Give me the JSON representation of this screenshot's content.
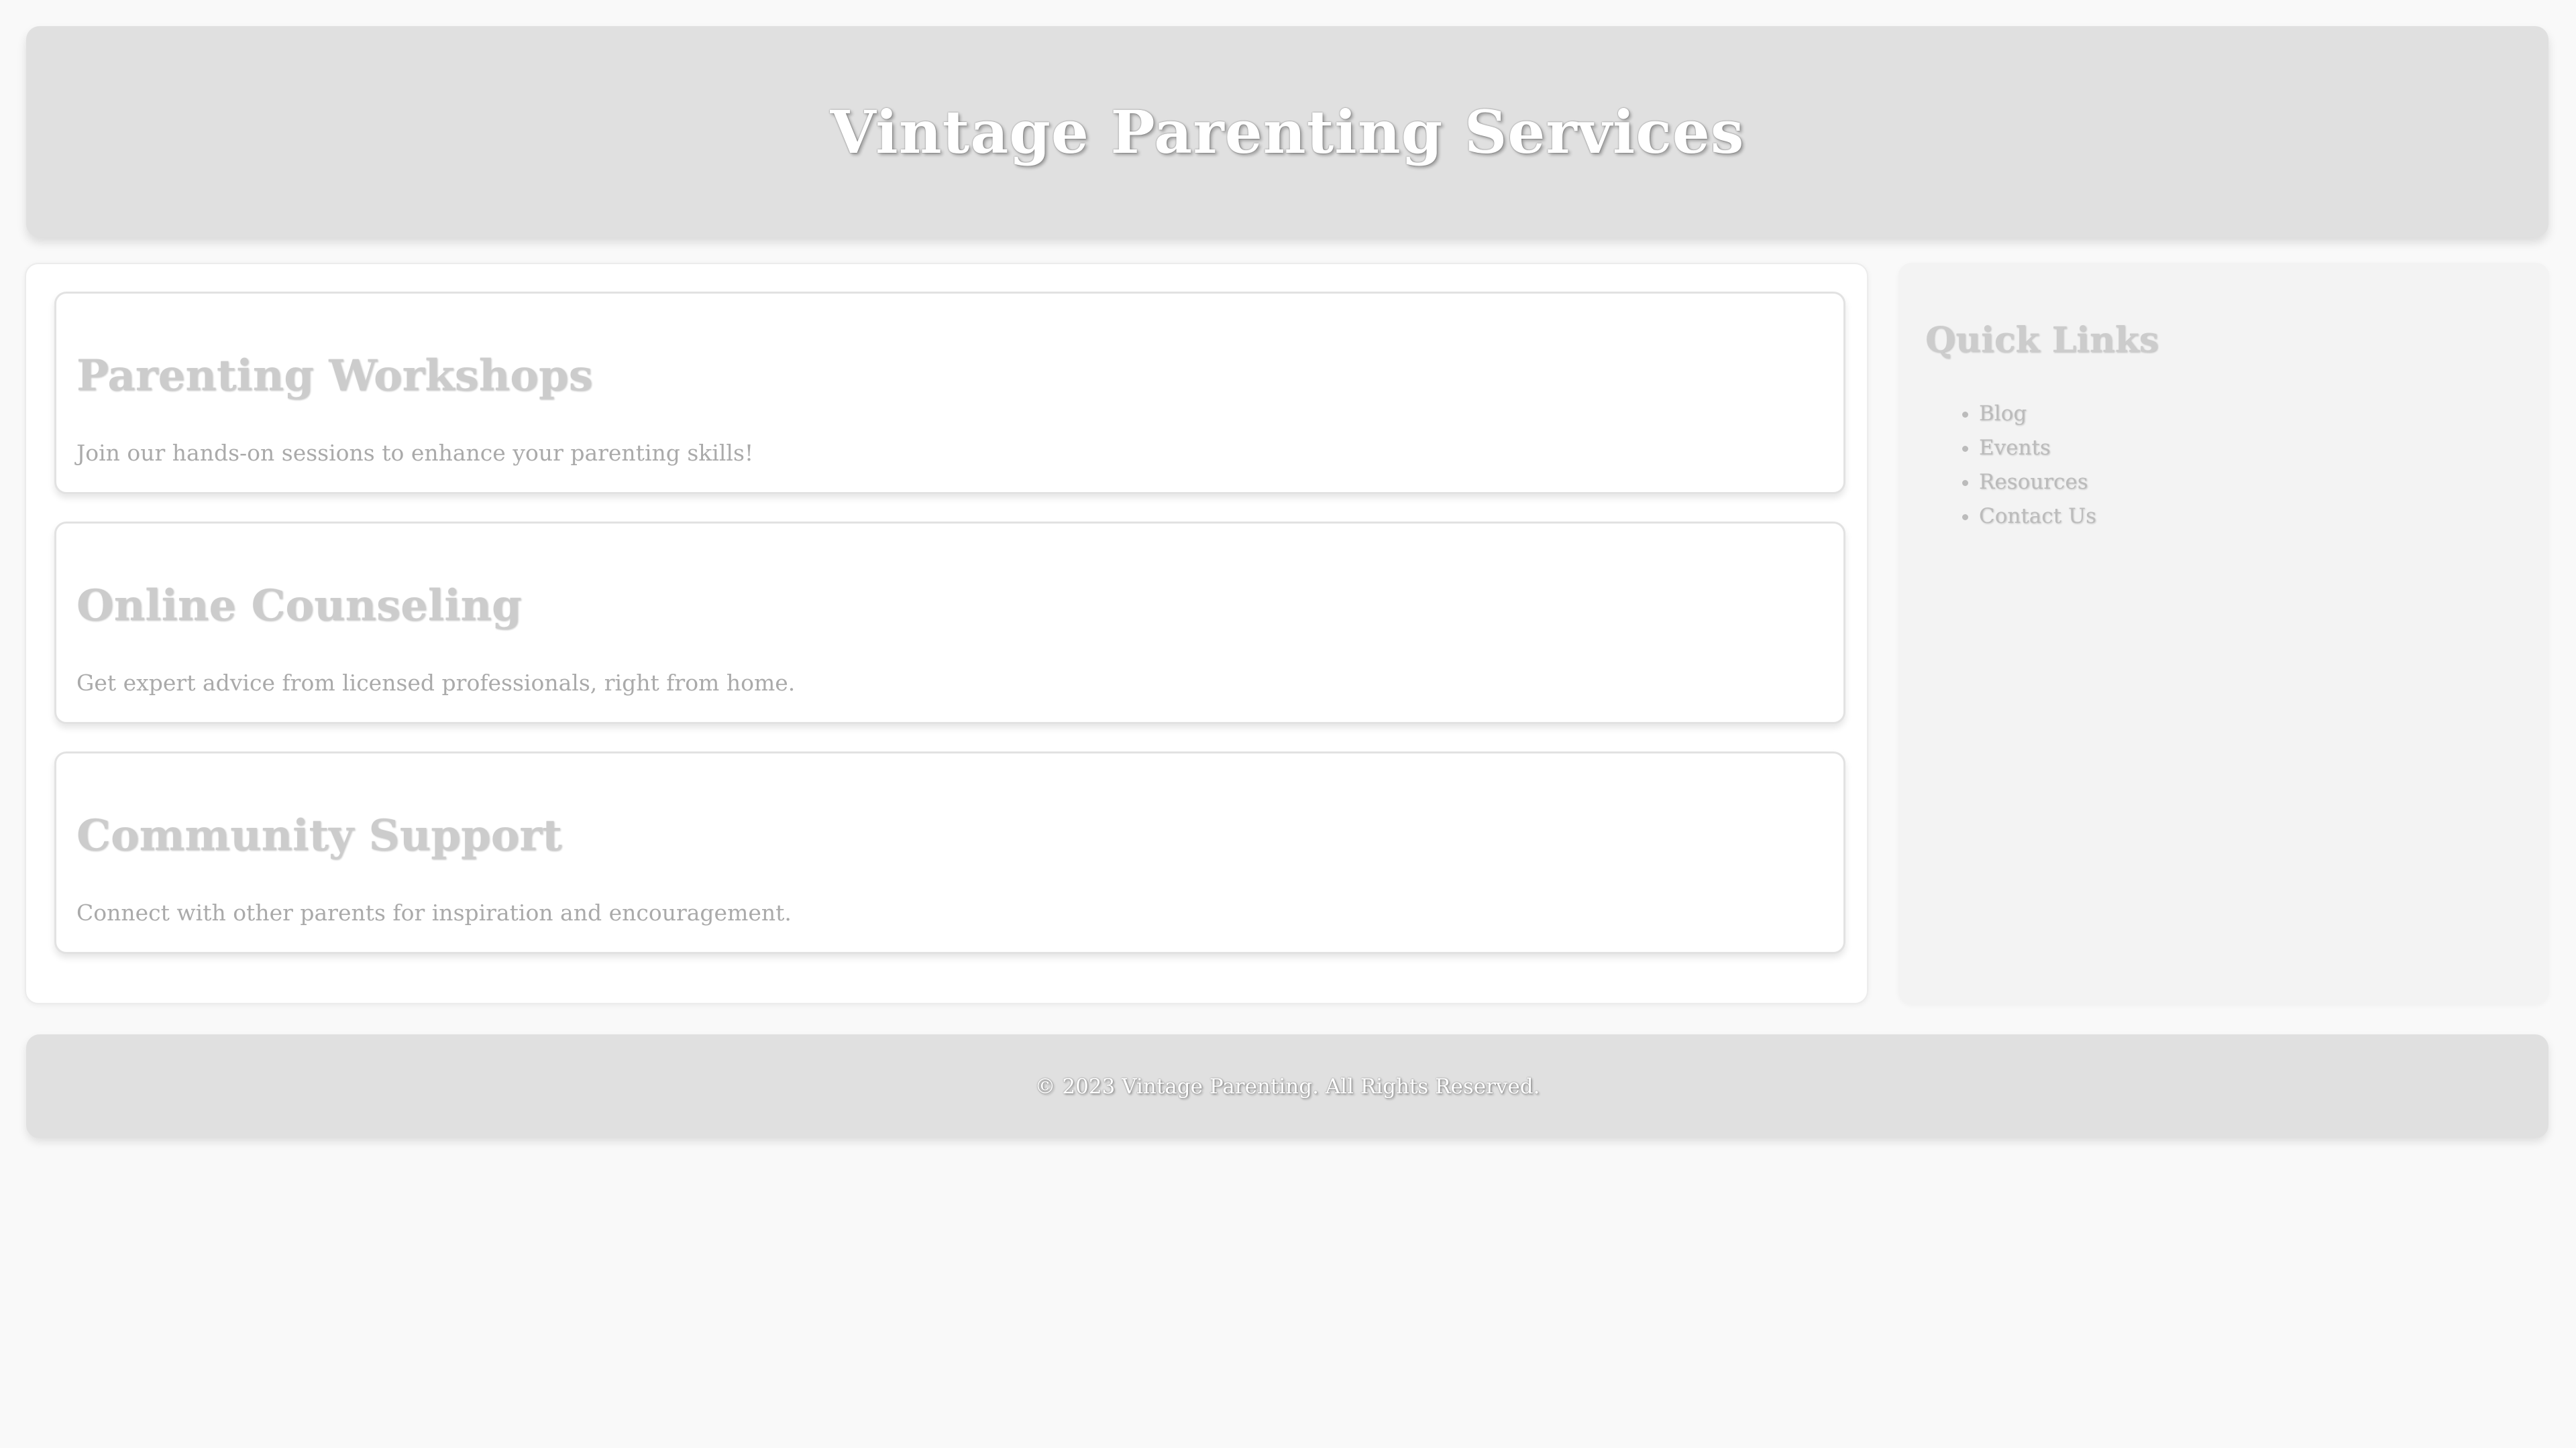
{
  "header": {
    "title": "Vintage Parenting Services"
  },
  "services": [
    {
      "title": "Parenting Workshops",
      "description": "Join our hands-on sessions to enhance your parenting skills!"
    },
    {
      "title": "Online Counseling",
      "description": "Get expert advice from licensed professionals, right from home."
    },
    {
      "title": "Community Support",
      "description": "Connect with other parents for inspiration and encouragement."
    }
  ],
  "sidebar": {
    "title": "Quick Links",
    "links": [
      "Blog",
      "Events",
      "Resources",
      "Contact Us"
    ]
  },
  "footer": {
    "text": "© 2023 Vintage Parenting. All Rights Reserved."
  },
  "colors": {
    "background": "#f9f9f9",
    "header_bg": "#e0e0e0",
    "heading_text": "#cccccc",
    "body_text": "#aaaaaa",
    "sidebar_bg": "#f3f3f3"
  }
}
